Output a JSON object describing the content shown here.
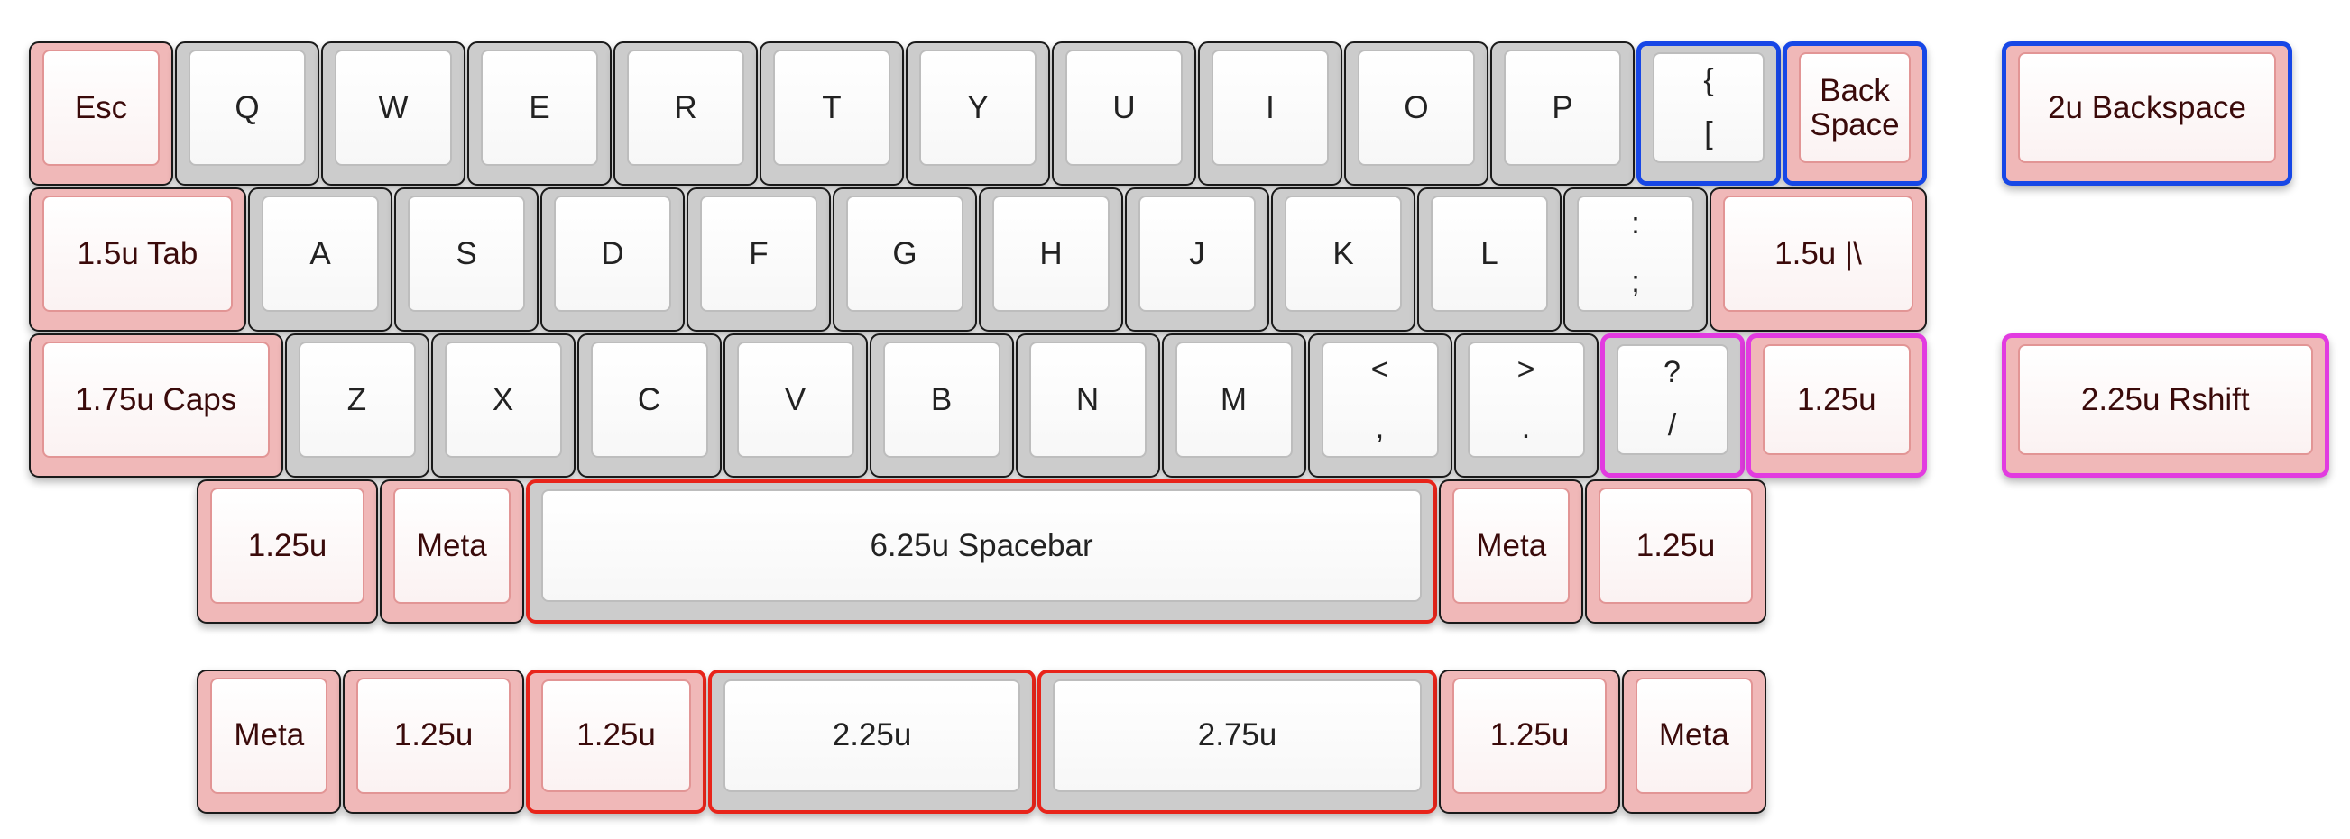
{
  "keyboard": {
    "name": "",
    "colors": {
      "alpha_base": "#cccccc",
      "mod_base": "#f0b8b8",
      "highlight_blue": "#1747e6",
      "highlight_magenta": "#e23be0",
      "highlight_red": "#e8241a",
      "legend_dark": "#3a0a0a"
    },
    "keys": [
      {
        "id": "esc",
        "color": "pink",
        "x": 0,
        "y": 0,
        "w": 1,
        "label": "Esc"
      },
      {
        "id": "q",
        "color": "grey",
        "x": 1,
        "y": 0,
        "w": 1,
        "label": "Q"
      },
      {
        "id": "w",
        "color": "grey",
        "x": 2,
        "y": 0,
        "w": 1,
        "label": "W"
      },
      {
        "id": "e",
        "color": "grey",
        "x": 3,
        "y": 0,
        "w": 1,
        "label": "E"
      },
      {
        "id": "r",
        "color": "grey",
        "x": 4,
        "y": 0,
        "w": 1,
        "label": "R"
      },
      {
        "id": "t",
        "color": "grey",
        "x": 5,
        "y": 0,
        "w": 1,
        "label": "T"
      },
      {
        "id": "y",
        "color": "grey",
        "x": 6,
        "y": 0,
        "w": 1,
        "label": "Y"
      },
      {
        "id": "u",
        "color": "grey",
        "x": 7,
        "y": 0,
        "w": 1,
        "label": "U"
      },
      {
        "id": "i",
        "color": "grey",
        "x": 8,
        "y": 0,
        "w": 1,
        "label": "I"
      },
      {
        "id": "o",
        "color": "grey",
        "x": 9,
        "y": 0,
        "w": 1,
        "label": "O"
      },
      {
        "id": "p",
        "color": "grey",
        "x": 10,
        "y": 0,
        "w": 1,
        "label": "P"
      },
      {
        "id": "bracket",
        "color": "grey",
        "x": 11,
        "y": 0,
        "w": 1,
        "top": "{",
        "bottom": "[",
        "border": "blue"
      },
      {
        "id": "backspace-split",
        "color": "pink",
        "x": 12,
        "y": 0,
        "w": 1,
        "label": "Back\nSpace",
        "border": "blue"
      },
      {
        "id": "backspace-2u",
        "color": "pink",
        "x": 13.5,
        "y": 0,
        "w": 2,
        "label": "2u Backspace",
        "border": "blue"
      },
      {
        "id": "tab",
        "color": "pink",
        "x": 0,
        "y": 1,
        "w": 1.5,
        "label": "1.5u Tab"
      },
      {
        "id": "a",
        "color": "grey",
        "x": 1.5,
        "y": 1,
        "w": 1,
        "label": "A"
      },
      {
        "id": "s",
        "color": "grey",
        "x": 2.5,
        "y": 1,
        "w": 1,
        "label": "S"
      },
      {
        "id": "d",
        "color": "grey",
        "x": 3.5,
        "y": 1,
        "w": 1,
        "label": "D"
      },
      {
        "id": "f",
        "color": "grey",
        "x": 4.5,
        "y": 1,
        "w": 1,
        "label": "F"
      },
      {
        "id": "g",
        "color": "grey",
        "x": 5.5,
        "y": 1,
        "w": 1,
        "label": "G"
      },
      {
        "id": "h",
        "color": "grey",
        "x": 6.5,
        "y": 1,
        "w": 1,
        "label": "H"
      },
      {
        "id": "j",
        "color": "grey",
        "x": 7.5,
        "y": 1,
        "w": 1,
        "label": "J"
      },
      {
        "id": "k",
        "color": "grey",
        "x": 8.5,
        "y": 1,
        "w": 1,
        "label": "K"
      },
      {
        "id": "l",
        "color": "grey",
        "x": 9.5,
        "y": 1,
        "w": 1,
        "label": "L"
      },
      {
        "id": "semicolon",
        "color": "grey",
        "x": 10.5,
        "y": 1,
        "w": 1,
        "top": ":",
        "bottom": ";"
      },
      {
        "id": "backslash",
        "color": "pink",
        "x": 11.5,
        "y": 1,
        "w": 1.5,
        "label": "1.5u |\\"
      },
      {
        "id": "caps",
        "color": "pink",
        "x": 0,
        "y": 2,
        "w": 1.75,
        "label": "1.75u Caps"
      },
      {
        "id": "z",
        "color": "grey",
        "x": 1.75,
        "y": 2,
        "w": 1,
        "label": "Z"
      },
      {
        "id": "x",
        "color": "grey",
        "x": 2.75,
        "y": 2,
        "w": 1,
        "label": "X"
      },
      {
        "id": "c",
        "color": "grey",
        "x": 3.75,
        "y": 2,
        "w": 1,
        "label": "C"
      },
      {
        "id": "v",
        "color": "grey",
        "x": 4.75,
        "y": 2,
        "w": 1,
        "label": "V"
      },
      {
        "id": "b",
        "color": "grey",
        "x": 5.75,
        "y": 2,
        "w": 1,
        "label": "B"
      },
      {
        "id": "n",
        "color": "grey",
        "x": 6.75,
        "y": 2,
        "w": 1,
        "label": "N"
      },
      {
        "id": "m",
        "color": "grey",
        "x": 7.75,
        "y": 2,
        "w": 1,
        "label": "M"
      },
      {
        "id": "comma",
        "color": "grey",
        "x": 8.75,
        "y": 2,
        "w": 1,
        "top": "<",
        "bottom": ","
      },
      {
        "id": "period",
        "color": "grey",
        "x": 9.75,
        "y": 2,
        "w": 1,
        "top": ">",
        "bottom": "."
      },
      {
        "id": "slash",
        "color": "grey",
        "x": 10.75,
        "y": 2,
        "w": 1,
        "top": "?",
        "bottom": "/",
        "border": "magenta"
      },
      {
        "id": "rshift-split",
        "color": "pink",
        "x": 11.75,
        "y": 2,
        "w": 1.25,
        "label": "1.25u",
        "border": "magenta"
      },
      {
        "id": "rshift-225",
        "color": "pink",
        "x": 13.5,
        "y": 2,
        "w": 2.25,
        "label": "2.25u Rshift",
        "border": "magenta"
      },
      {
        "id": "b1-ctrl",
        "color": "pink",
        "x": 1.15,
        "y": 3,
        "w": 1.25,
        "label": "1.25u"
      },
      {
        "id": "b1-meta-l",
        "color": "pink",
        "x": 2.4,
        "y": 3,
        "w": 1,
        "label": "Meta"
      },
      {
        "id": "b1-space",
        "color": "grey",
        "x": 3.4,
        "y": 3,
        "w": 6.25,
        "label": "6.25u Spacebar",
        "border": "red"
      },
      {
        "id": "b1-meta-r",
        "color": "pink",
        "x": 9.65,
        "y": 3,
        "w": 1,
        "label": "Meta"
      },
      {
        "id": "b1-ctrl-r",
        "color": "pink",
        "x": 10.65,
        "y": 3,
        "w": 1.25,
        "label": "1.25u"
      },
      {
        "id": "b2-meta-l",
        "color": "pink",
        "x": 1.15,
        "y": 4.3,
        "w": 1,
        "label": "Meta"
      },
      {
        "id": "b2-125-a",
        "color": "pink",
        "x": 2.15,
        "y": 4.3,
        "w": 1.25,
        "label": "1.25u"
      },
      {
        "id": "b2-125-b",
        "color": "pink",
        "x": 3.4,
        "y": 4.3,
        "w": 1.25,
        "label": "1.25u",
        "border": "red"
      },
      {
        "id": "b2-225",
        "color": "grey",
        "x": 4.65,
        "y": 4.3,
        "w": 2.25,
        "label": "2.25u",
        "border": "red"
      },
      {
        "id": "b2-275",
        "color": "grey",
        "x": 6.9,
        "y": 4.3,
        "w": 2.75,
        "label": "2.75u",
        "border": "red"
      },
      {
        "id": "b2-125-c",
        "color": "pink",
        "x": 9.65,
        "y": 4.3,
        "w": 1.25,
        "label": "1.25u"
      },
      {
        "id": "b2-meta-r",
        "color": "pink",
        "x": 10.9,
        "y": 4.3,
        "w": 1,
        "label": "Meta"
      }
    ]
  }
}
